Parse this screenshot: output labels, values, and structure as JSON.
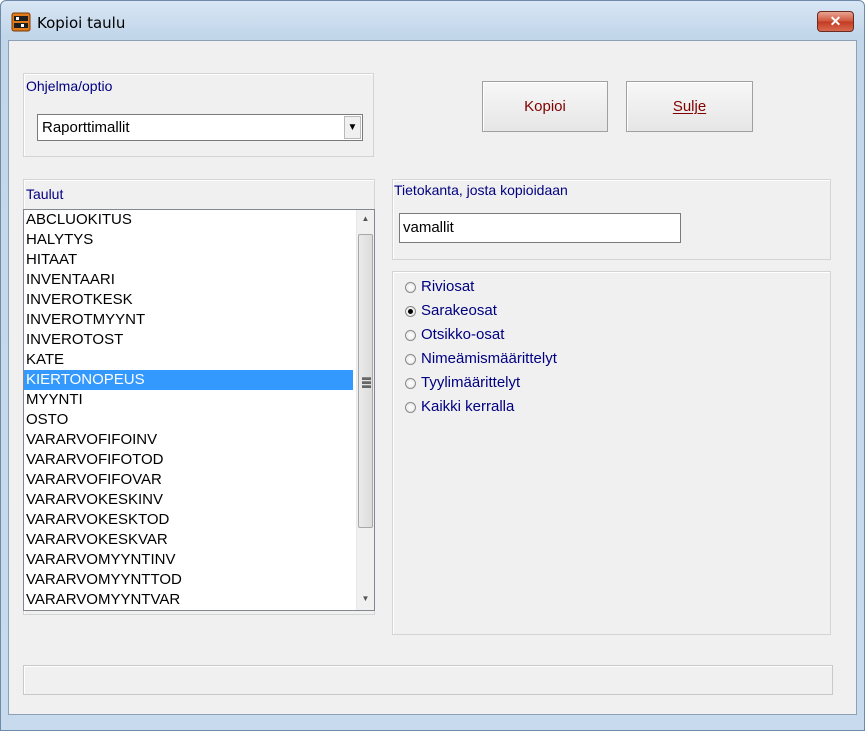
{
  "window": {
    "title": "Kopioi taulu",
    "close_glyph": "✕"
  },
  "program": {
    "label": "Ohjelma/optio",
    "selected": "Raporttimallit",
    "dropdown_glyph": "▼"
  },
  "buttons": {
    "copy": "Kopioi",
    "close": "Sulje"
  },
  "tables": {
    "label": "Taulut",
    "items": [
      "ABCLUOKITUS",
      "HALYTYS",
      "HITAAT",
      "INVENTAARI",
      "INVEROTKESK",
      "INVEROTMYYNT",
      "INVEROTOST",
      "KATE",
      "KIERTONOPEUS",
      "MYYNTI",
      "OSTO",
      "VARARVOFIFOINV",
      "VARARVOFIFOTOD",
      "VARARVOFIFOVAR",
      "VARARVOKESKINV",
      "VARARVOKESKTOD",
      "VARARVOKESKVAR",
      "VARARVOMYYNTINV",
      "VARARVOMYYNTTOD",
      "VARARVOMYYNTVAR"
    ],
    "selected": "KIERTONOPEUS",
    "scroll_up": "▲",
    "scroll_down": "▼"
  },
  "source_db": {
    "label": "Tietokanta, josta kopioidaan",
    "value": "vamallit"
  },
  "options": {
    "items": [
      "Riviosat",
      "Sarakeosat",
      "Otsikko-osat",
      "Nimeämismäärittelyt",
      "Tyylimäärittelyt",
      "Kaikki kerralla"
    ],
    "selected": "Sarakeosat"
  },
  "status": {
    "text": ""
  }
}
